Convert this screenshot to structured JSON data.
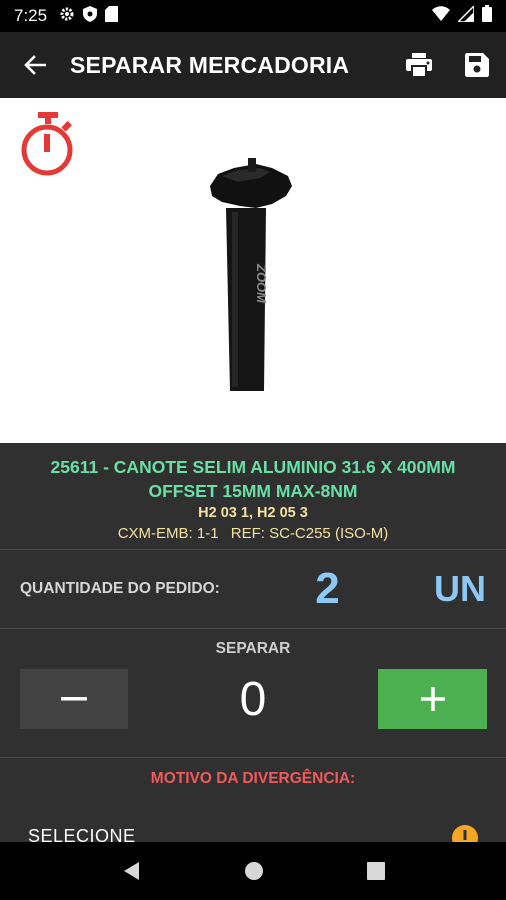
{
  "status_bar": {
    "time": "7:25",
    "left_icons": [
      "settings-icon",
      "shield-icon",
      "sd-card-icon"
    ],
    "right_icons": [
      "wifi-icon",
      "signal-icon",
      "battery-icon"
    ]
  },
  "app_bar": {
    "title": "SEPARAR MERCADORIA",
    "actions": [
      "print-icon",
      "save-icon"
    ]
  },
  "product": {
    "name_line1": "25611 - CANOTE SELIM ALUMINIO 31.6 X 400MM",
    "name_line2": "OFFSET 15MM MAX-8NM",
    "location": "H2 03 1, H2 05 3",
    "packaging": "CXM-EMB: 1-1",
    "reference": "REF: SC-C255 (ISO-M)",
    "brand_mark": "ZOOM"
  },
  "order": {
    "label": "QUANTIDADE DO PEDIDO:",
    "quantity": "2",
    "unit": "UN"
  },
  "separate": {
    "label": "SEPARAR",
    "value": "0",
    "minus_symbol": "−",
    "plus_symbol": "+"
  },
  "divergence": {
    "label": "MOTIVO DA DIVERGÊNCIA:",
    "select_text": "SELECIONE"
  },
  "colors": {
    "accent_green": "#4caf50",
    "product_name": "#69e0a5",
    "info_yellow": "#f3e1a2",
    "quantity_blue": "#8ec8f5",
    "warning_red": "#f05a5a",
    "timer_red": "#e53935"
  }
}
